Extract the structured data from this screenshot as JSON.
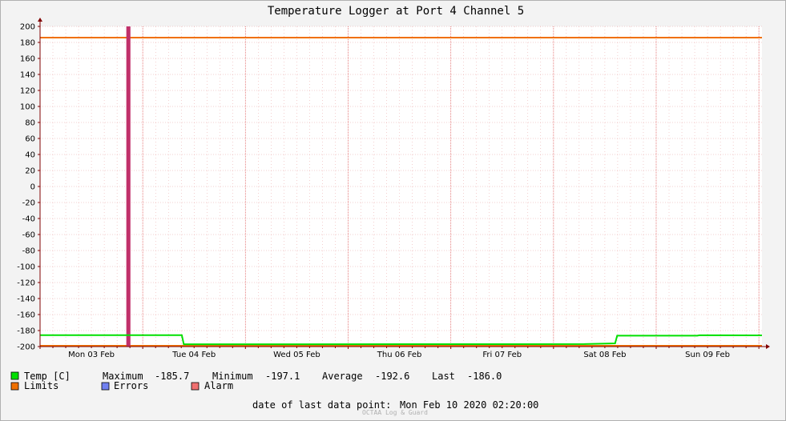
{
  "chart_data": {
    "type": "line",
    "title": "Temperature Logger at Port 4 Channel 5",
    "ylim": [
      -200,
      200
    ],
    "y_ticks": [
      200,
      180,
      160,
      140,
      120,
      100,
      80,
      60,
      40,
      20,
      0,
      -20,
      -40,
      -60,
      -80,
      -100,
      -120,
      -140,
      -160,
      -180,
      -200
    ],
    "x_range_days": [
      0,
      7.03
    ],
    "x_ticks": [
      {
        "label": "Mon 03 Feb",
        "day": 0.5
      },
      {
        "label": "Tue 04 Feb",
        "day": 1.5
      },
      {
        "label": "Wed 05 Feb",
        "day": 2.5
      },
      {
        "label": "Thu 06 Feb",
        "day": 3.5
      },
      {
        "label": "Fri 07 Feb",
        "day": 4.5
      },
      {
        "label": "Sat 08 Feb",
        "day": 5.5
      },
      {
        "label": "Sun 09 Feb",
        "day": 6.5
      }
    ],
    "series": [
      {
        "name": "Temp [C]",
        "color": "#00e000",
        "x": [
          0.0,
          1.38,
          1.4,
          2.5,
          4.0,
          5.3,
          5.6,
          5.62,
          6.4,
          6.42,
          7.03
        ],
        "y": [
          -185.7,
          -185.7,
          -197.1,
          -197.1,
          -197.0,
          -196.9,
          -196.0,
          -186.4,
          -186.4,
          -185.9,
          -186.0
        ]
      }
    ],
    "limits": {
      "name": "Limits",
      "color": "#f07000",
      "upper": 186,
      "lower": -199
    },
    "alarm": {
      "name": "Alarm",
      "color": "#c0306a",
      "x_start": 0.84,
      "x_end": 0.88
    },
    "errors": {
      "name": "Errors",
      "color": "#7080f0"
    }
  },
  "legend": {
    "temp_label": "Temp [C]",
    "max_label": "Maximum",
    "max_value": "-185.7",
    "min_label": "Minimum",
    "min_value": "-197.1",
    "avg_label": "Average",
    "avg_value": "-192.6",
    "last_label": "Last",
    "last_value": "-186.0",
    "limits_label": "Limits",
    "errors_label": "Errors",
    "alarm_label": "Alarm"
  },
  "footer": {
    "last_point_label": "date of last data point:",
    "last_point_value": "Mon Feb 10 2020 02:20:00",
    "watermark": "OCTAA Log & Guard"
  },
  "colors": {
    "plot_bg": "#ffffff",
    "grid": "#e8a0a0",
    "axis": "#800000",
    "temp_swatch": "#00e000",
    "limits_swatch": "#f07000",
    "errors_swatch": "#7080f0",
    "alarm_swatch": "#f07070"
  }
}
